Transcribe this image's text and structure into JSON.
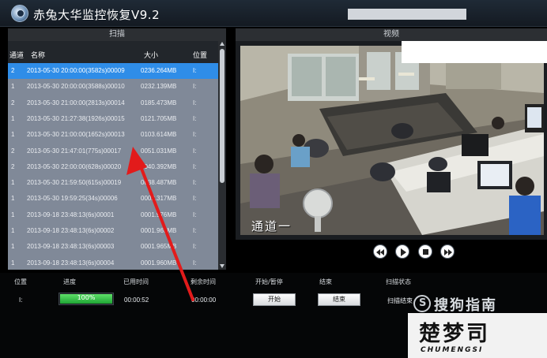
{
  "app": {
    "title": "赤兔大华监控恢复V9.2"
  },
  "scan_panel": {
    "title": "扫描",
    "columns": {
      "channel": "通道",
      "name": "名称",
      "size": "大小",
      "position": "位置"
    },
    "rows": [
      {
        "channel": "2",
        "name": "2013-05-30 20:00:00(3582s)00009",
        "size": "0236.264MB",
        "position": "I:"
      },
      {
        "channel": "1",
        "name": "2013-05-30 20:00:00(3588s)00010",
        "size": "0232.139MB",
        "position": "I:"
      },
      {
        "channel": "2",
        "name": "2013-05-30 21:00:00(2813s)00014",
        "size": "0185.473MB",
        "position": "I:"
      },
      {
        "channel": "1",
        "name": "2013-05-30 21:27:38(1926s)00015",
        "size": "0121.705MB",
        "position": "I:"
      },
      {
        "channel": "1",
        "name": "2013-05-30 21:00:00(1652s)00013",
        "size": "0103.614MB",
        "position": "I:"
      },
      {
        "channel": "2",
        "name": "2013-05-30 21:47:01(775s)00017",
        "size": "0051.031MB",
        "position": "I:"
      },
      {
        "channel": "2",
        "name": "2013-05-30 22:00:00(628s)00020",
        "size": "0040.392MB",
        "position": "I:"
      },
      {
        "channel": "1",
        "name": "2013-05-30 21:59:50(615s)00019",
        "size": "0038.487MB",
        "position": "I:"
      },
      {
        "channel": "1",
        "name": "2013-05-30 19:59:25(34s)00006",
        "size": "0002.317MB",
        "position": "I:"
      },
      {
        "channel": "1",
        "name": "2013-09-18 23:48:13(6s)00001",
        "size": "0001.976MB",
        "position": "I:"
      },
      {
        "channel": "1",
        "name": "2013-09-18 23:48:13(6s)00002",
        "size": "0001.965MB",
        "position": "I:"
      },
      {
        "channel": "1",
        "name": "2013-09-18 23:48:13(6s)00003",
        "size": "0001.965MB",
        "position": "I:"
      },
      {
        "channel": "1",
        "name": "2013-09-18 23:48:13(6s)00004",
        "size": "0001.960MB",
        "position": "I:"
      }
    ],
    "selected_index": 0
  },
  "video_panel": {
    "title": "视频",
    "overlay_label": "通道一"
  },
  "playback": {
    "prev": "rewind-icon",
    "play": "play-icon",
    "stop": "stop-icon",
    "next": "fast-forward-icon"
  },
  "progress": {
    "columns": {
      "position": "位置",
      "progress": "进度",
      "elapsed": "已用时间",
      "remaining": "剩余时间",
      "startpause": "开始/暂停",
      "end": "结束",
      "status": "扫描状态"
    },
    "position": "I:",
    "percent_value": 100,
    "percent_text": "100%",
    "elapsed": "00:00:52",
    "remaining": "00:00:00",
    "start_label": "开始",
    "end_label": "结束",
    "status": "扫描结束"
  },
  "watermarks": {
    "sogou": "搜狗指南",
    "chumengsi_big": "楚梦司",
    "chumengsi_small": "CHUMENGSI"
  },
  "colors": {
    "selected_row": "#2f8de8",
    "list_bg": "#808998",
    "progress_fill": "#22b33a",
    "annotation_arrow": "#e21b1b"
  }
}
